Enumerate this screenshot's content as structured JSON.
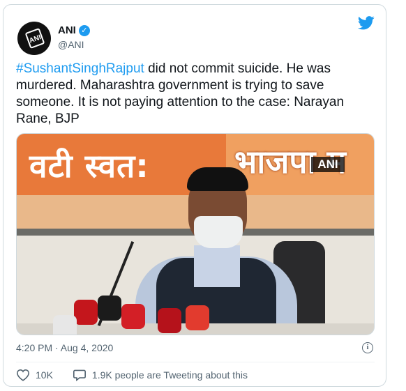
{
  "author": {
    "name": "ANI",
    "handle": "@ANI",
    "avatar_text": "ANI"
  },
  "tweet": {
    "hashtag": "#SushantSinghRajput",
    "body": " did not commit suicide. He was murdered. Maharashtra government is trying to save someone. It is not paying attention to the case: Narayan Rane, BJP"
  },
  "media": {
    "banner_left_text": "वटी स्वत:",
    "banner_right_text": "भाजपा म",
    "watermark": "ANI"
  },
  "meta": {
    "timestamp": "4:20 PM · Aug 4, 2020"
  },
  "actions": {
    "likes": "10K",
    "conversation": "1.9K people are Tweeting about this"
  },
  "colors": {
    "accent": "#1d9bf0",
    "text": "#0f1419",
    "muted": "#536471"
  },
  "icons": {
    "verified": "verified-badge-icon",
    "twitter": "twitter-bird-icon",
    "info": "info-icon",
    "like": "heart-icon",
    "reply": "speech-bubble-icon"
  }
}
